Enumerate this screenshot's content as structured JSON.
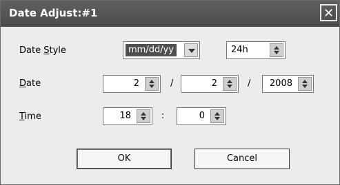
{
  "window": {
    "title": "Date Adjust:#1",
    "close_glyph": "✕"
  },
  "date_style": {
    "label_pre": "Date ",
    "label_ul": "S",
    "label_post": "tyle",
    "format_value": "mm/dd/yy",
    "clock_value": "24h"
  },
  "date": {
    "label_ul": "D",
    "label_post": "ate",
    "month": "2",
    "day": "2",
    "year": "2008",
    "separator": "/"
  },
  "time": {
    "label_ul": "T",
    "label_post": "ime",
    "hour": "18",
    "minute": "0",
    "separator": ":"
  },
  "buttons": {
    "ok": "OK",
    "cancel": "Cancel"
  },
  "icons": {
    "spinner": "spinner-up-down-icon",
    "dropdown": "chevron-down-icon",
    "close": "close-icon"
  }
}
